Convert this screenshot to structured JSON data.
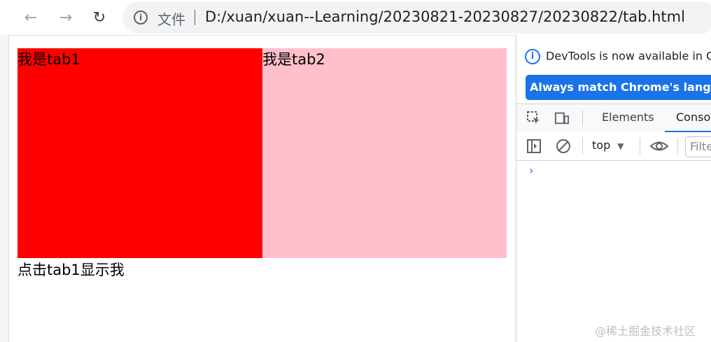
{
  "browser": {
    "back_icon": "←",
    "forward_icon": "→",
    "reload_icon": "↻",
    "info_icon": "i",
    "file_label": "文件",
    "url": "D:/xuan/xuan--Learning/20230821-20230827/20230822/tab.html"
  },
  "page": {
    "tabs": [
      {
        "label": "我是tab1",
        "color": "#ff0000"
      },
      {
        "label": "我是tab2",
        "color": "#ffc0cb"
      }
    ],
    "content": "点击tab1显示我"
  },
  "devtools": {
    "notice": "DevTools is now available in C",
    "lang_button": "Always match Chrome's languag",
    "tabs": [
      "Elements",
      "Conso"
    ],
    "active_tab": "Conso",
    "context": "top",
    "filter_placeholder": "Filte",
    "prompt": "›",
    "accent": "#1a73e8"
  },
  "watermark": "@稀土掘金技术社区"
}
